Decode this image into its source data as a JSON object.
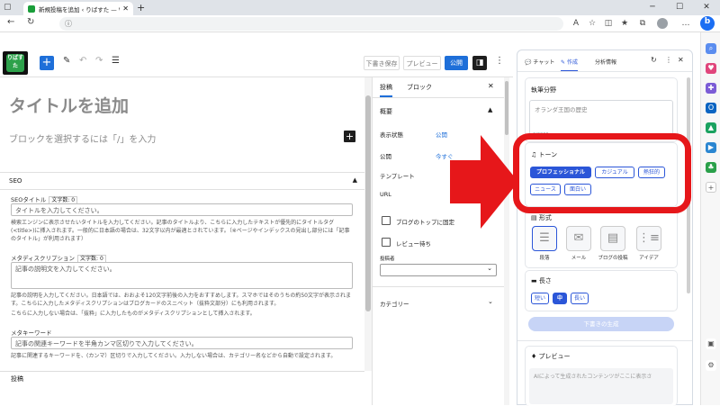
{
  "browser": {
    "tab_title": "新規投稿を追加 ‹ りばすた — Wor…",
    "tab_close": "✕",
    "newtab": "+",
    "win_min": "─",
    "win_max": "☐",
    "win_close": "✕",
    "addr_icon": "ⓘ"
  },
  "toolbar": {
    "draft_label": "下書き保存",
    "preview_label": "プレビュー",
    "publish_label": "公開",
    "add_label": "+",
    "logo_text": "りばすた"
  },
  "editor": {
    "title_placeholder": "タイトルを追加",
    "block_hint": "ブロックを選択するには「/」を入力",
    "plus": "+"
  },
  "seo": {
    "header": "SEO",
    "title_label": "SEOタイトル",
    "title_count": "文字数: 0",
    "title_placeholder": "タイトルを入力してください。",
    "title_help": "検索エンジンに表示させたいタイトルを入力してください。記事のタイトルより、こちらに入力したテキストが優先的にタイトルタグ(<title>)に挿入されます。一般的に日本語の場合は、32文字以内が最適とされています。（※ページやインデックスの見出し部分には「記事のタイトル」が利用されます）",
    "desc_label": "メタディスクリプション",
    "desc_count": "文字数: 0",
    "desc_placeholder": "記事の説明文を入力してください。",
    "desc_help1": "記事の説明を入力してください。日本語では、おおよそ120文字前後の入力をおすすめします。スマホではそのうちの約50文字が表示されます。こちらに入力したメタディスクリプションはブログカードのスニペット（抜粋文部分）にも利用されます。",
    "desc_help2": "こちらに入力しない場合は、「抜粋」に入力したものがメタディスクリプションとして挿入されます。",
    "kw_label": "メタキーワード",
    "kw_placeholder": "記事の関連キーワードを半角カンマ区切りで入力してください。",
    "kw_help": "記事に関連するキーワードを、(カンマ）区切りで入力してください。入力しない場合は、カテゴリー名などから自動で設定されます。",
    "footer": "投稿"
  },
  "settings": {
    "tab_post": "投稿",
    "tab_block": "ブロック",
    "close": "✕",
    "summary": "概要",
    "visibility_label": "表示状態",
    "visibility_value": "公開",
    "publish_label": "公開",
    "publish_value": "今すぐ",
    "template_label": "テンプレート",
    "url_label": "URL",
    "sticky_label": "ブログのトップに固定",
    "review_label": "レビュー待ち",
    "author_label": "投稿者",
    "category_label": "カテゴリー"
  },
  "ai": {
    "tab_chat": "チャット",
    "tab_create": "作成",
    "tab_analysis": "分析情報",
    "field_label": "執筆分野",
    "field_placeholder": "オランダ王国の歴史",
    "field_count": "0/2000",
    "tone_label": "トーン",
    "tones": [
      "プロフェッショナル",
      "カジュアル",
      "熱狂的",
      "ニュース",
      "面白い"
    ],
    "format_label": "形式",
    "formats": [
      "段落",
      "メール",
      "ブログの投稿",
      "アイデア"
    ],
    "length_label": "長さ",
    "lengths": [
      "短い",
      "中",
      "長い"
    ],
    "generate_label": "下書きの生成",
    "preview_label": "プレビュー",
    "preview_placeholder": "AIによって生成されたコンテンツがここに表示さ"
  },
  "colors": {
    "accent": "#2b56d8",
    "wp_blue": "#1e6fd9",
    "annotation_red": "#e6171a"
  }
}
